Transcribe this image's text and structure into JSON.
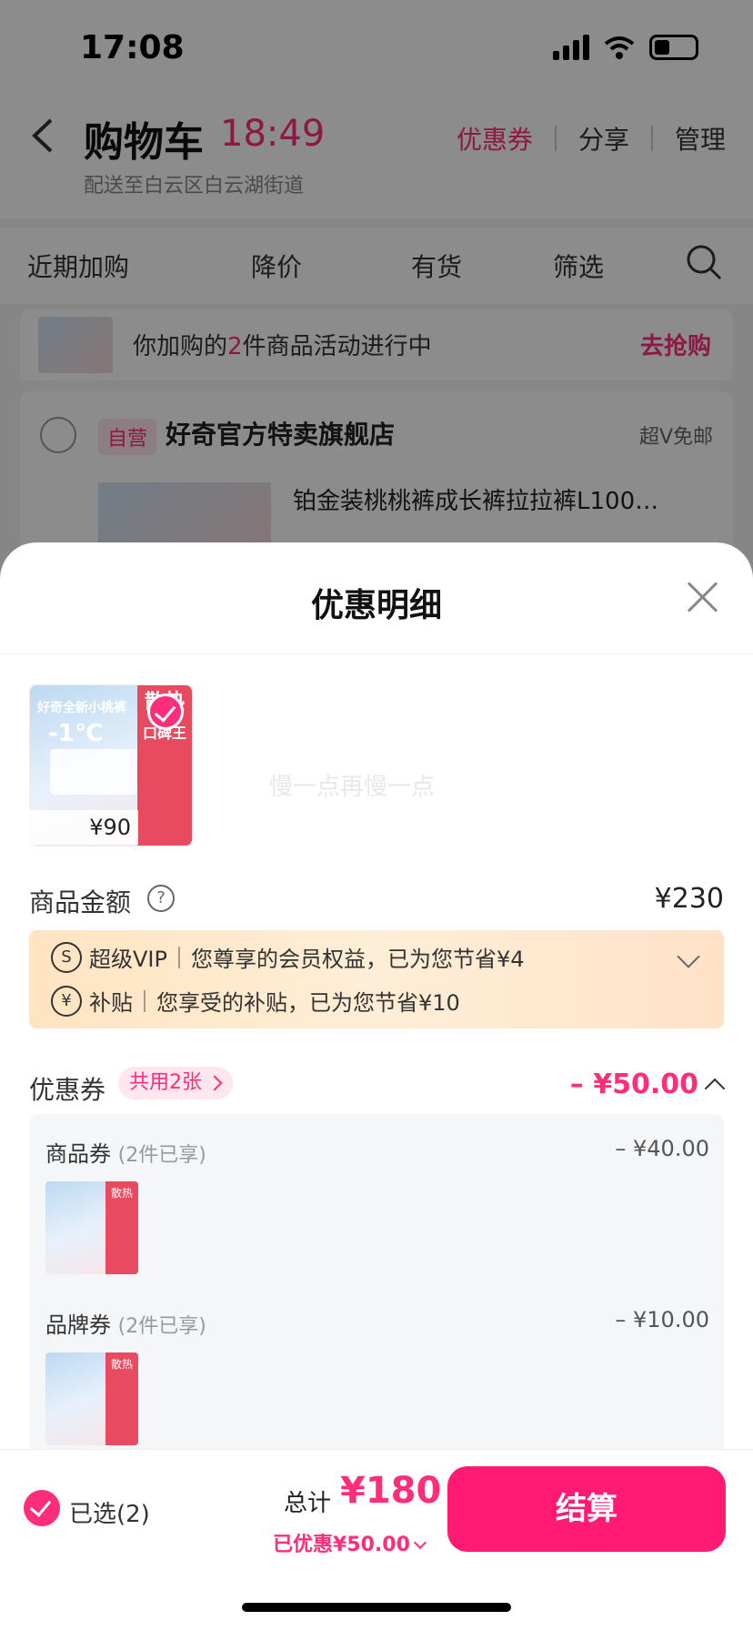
{
  "status_bar": {
    "time": "17:08"
  },
  "cart_page": {
    "title": "购物车",
    "time": "18:49",
    "delivery": "配送至白云区白云湖街道",
    "header_links": {
      "coupon": "优惠券",
      "share": "分享",
      "manage": "管理"
    },
    "filters": [
      "近期加购",
      "降价",
      "有货",
      "筛选"
    ],
    "promo": {
      "prefix": "你加购的",
      "count": "2",
      "suffix": "件商品活动进行中",
      "action": "去抢购"
    },
    "store": {
      "tag": "自营",
      "name": "好奇官方特卖旗舰店",
      "shipping": "超V免邮",
      "item_title": "铂金装桃桃裤成长裤拉拉裤L100…"
    }
  },
  "sheet": {
    "title": "优惠明细",
    "product": {
      "price": "¥90",
      "label": "好奇全新小桃裤",
      "temp": "-1℃",
      "side_text_1": "散热",
      "side_text_2": "口碑王"
    },
    "watermark": "慢一点再慢一点",
    "goods_amount": {
      "label": "商品金额",
      "value": "¥230"
    },
    "benefits": [
      {
        "icon": "S",
        "name": "超级VIP",
        "desc": "您尊享的会员权益，已为您节省¥4"
      },
      {
        "icon": "¥",
        "name": "补贴",
        "desc": "您享受的补贴，已为您节省¥10"
      }
    ],
    "coupon": {
      "label": "优惠券",
      "pill": "共用2张",
      "total": "– ¥50.00"
    },
    "coupon_items": [
      {
        "name": "商品券",
        "note": "(2件已享)",
        "amount": "– ¥40.00"
      },
      {
        "name": "品牌券",
        "note": "(2件已享)",
        "amount": "– ¥10.00"
      }
    ]
  },
  "footer": {
    "selected": "已选(2)",
    "total_label": "总计",
    "total_value": "¥180",
    "saved": "已优惠¥50.00",
    "checkout": "结算"
  },
  "colors": {
    "accent": "#ff2d7a",
    "checkout": "#ff1a74"
  }
}
